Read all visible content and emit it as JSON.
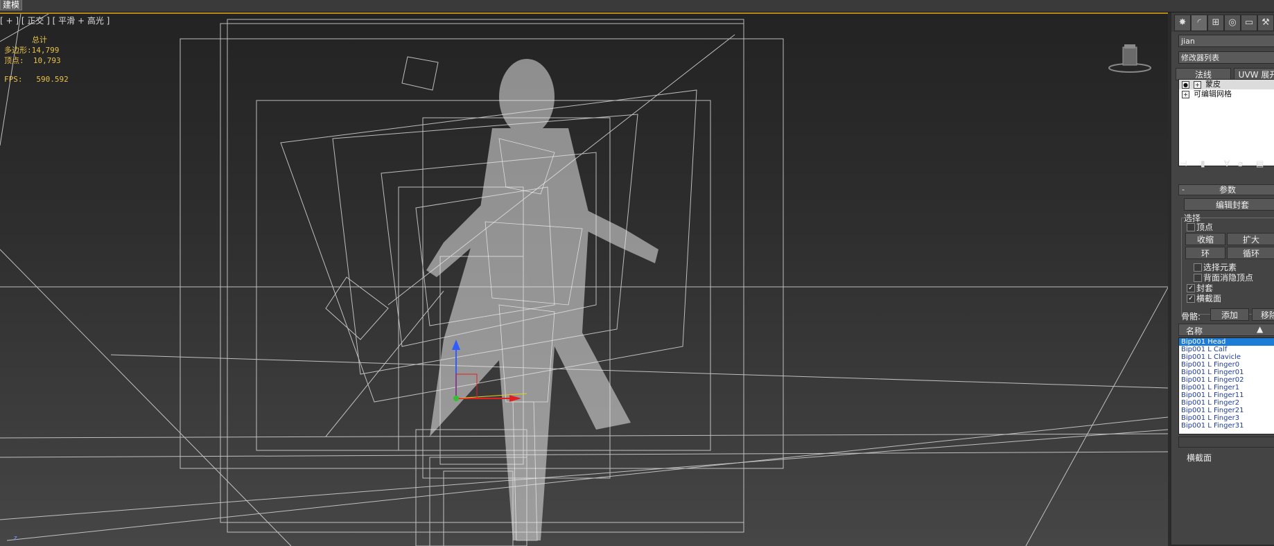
{
  "window": {
    "title": "建模"
  },
  "viewport": {
    "label": "[ + ] [ 正交 ] [ 平滑 + 高光 ]",
    "stats": {
      "header": "总计",
      "polys_label": "多边形:",
      "polys_value": "14,799",
      "verts_label": "顶点:",
      "verts_value": "10,793",
      "fps_label": "FPS:",
      "fps_value": "590.592"
    },
    "axis_marker": "z"
  },
  "panel": {
    "tabs": [
      "create-icon",
      "modify-icon",
      "hierarchy-icon",
      "motion-icon",
      "display-icon"
    ],
    "object_name": "jian",
    "modifier_list": "修改器列表",
    "buttons": {
      "normal": "法线",
      "uvw": "UVW 展开"
    },
    "stack": [
      {
        "label": "蒙皮",
        "selected": true
      },
      {
        "label": "可编辑网格",
        "selected": false
      }
    ],
    "params": {
      "header_minus": "-",
      "header": "参数",
      "edit_envelope": "编辑封套",
      "select_group": "选择",
      "vertex": "顶点",
      "shrink": "收缩",
      "grow": "扩大",
      "ring": "环",
      "loop": "循环",
      "select_element": "选择元素",
      "backface_cull": "背面消隐顶点",
      "envelope": "封套",
      "cross_section": "横截面",
      "bones_label": "骨骼:",
      "add": "添加",
      "remove": "移除",
      "name_col": "名称",
      "cross_section_footer": "横截面"
    },
    "checkboxes": {
      "vertex": false,
      "select_element": false,
      "backface_cull": false,
      "envelope": true,
      "cross_section": true
    },
    "bones": [
      "Bip001 Head",
      "Bip001 L Calf",
      "Bip001 L Clavicle",
      "Bip001 L Finger0",
      "Bip001 L Finger01",
      "Bip001 L Finger02",
      "Bip001 L Finger1",
      "Bip001 L Finger11",
      "Bip001 L Finger2",
      "Bip001 L Finger21",
      "Bip001 L Finger3",
      "Bip001 L Finger31"
    ],
    "selected_bone": 0
  },
  "colors": {
    "accent_frame": "#b98b1f",
    "selection": "#1c7cd6",
    "stats_text": "#e8c24a"
  }
}
